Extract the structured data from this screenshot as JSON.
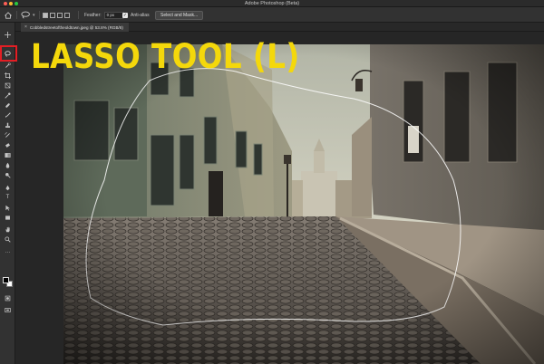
{
  "window": {
    "app_title": "Adobe Photoshop (Beta)"
  },
  "options_bar": {
    "feather_label": "Feather:",
    "feather_value": "0 px",
    "antialias_label": "Anti-alias",
    "antialias_checked": true,
    "select_mask_label": "Select and Mask..."
  },
  "document": {
    "tab_label": "Cobbledstreetoftheoldtown.jpeg @ 53.8% (RGB/8)"
  },
  "toolbar": {
    "active_tool": "lasso-tool",
    "highlight_color": "#e31e24",
    "tools": [
      {
        "name": "move-tool",
        "icon": "move-icon"
      },
      {
        "name": "lasso-tool",
        "icon": "lasso-icon"
      },
      {
        "name": "quick-selection-tool",
        "icon": "quick-selection-icon"
      },
      {
        "name": "crop-tool",
        "icon": "crop-icon"
      },
      {
        "name": "frame-tool",
        "icon": "frame-icon"
      },
      {
        "name": "eyedropper-tool",
        "icon": "eyedropper-icon"
      },
      {
        "name": "healing-brush-tool",
        "icon": "bandage-icon"
      },
      {
        "name": "brush-tool",
        "icon": "brush-icon"
      },
      {
        "name": "clone-stamp-tool",
        "icon": "stamp-icon"
      },
      {
        "name": "history-brush-tool",
        "icon": "history-brush-icon"
      },
      {
        "name": "eraser-tool",
        "icon": "eraser-icon"
      },
      {
        "name": "gradient-tool",
        "icon": "gradient-icon"
      },
      {
        "name": "blur-tool",
        "icon": "drop-icon"
      },
      {
        "name": "dodge-tool",
        "icon": "dodge-icon"
      },
      {
        "name": "pen-tool",
        "icon": "pen-icon"
      },
      {
        "name": "type-tool",
        "icon": "type-icon"
      },
      {
        "name": "path-selection-tool",
        "icon": "arrow-icon"
      },
      {
        "name": "rectangle-tool",
        "icon": "rectangle-icon"
      },
      {
        "name": "hand-tool",
        "icon": "hand-icon"
      },
      {
        "name": "zoom-tool",
        "icon": "magnifier-icon"
      },
      {
        "name": "edit-toolbar",
        "icon": "ellipsis-icon"
      }
    ],
    "type_glyph": "T",
    "ellipsis_glyph": "···",
    "foreground_color": "#000000",
    "background_color": "#ffffff"
  },
  "canvas": {
    "overlay_title": "LASSO TOOL (L)",
    "overlay_title_color": "#f4d80b"
  }
}
